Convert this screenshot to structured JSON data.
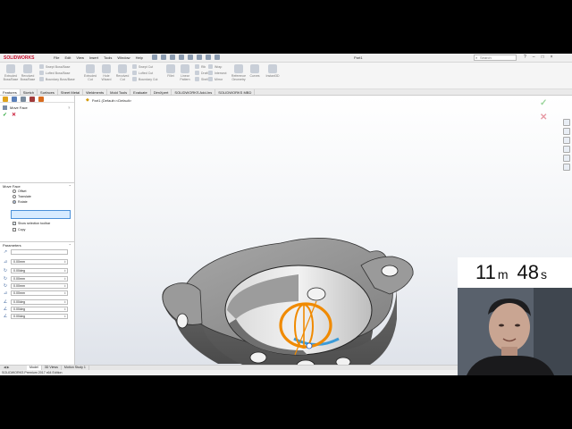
{
  "app": {
    "brand": "SOLIDWORKS",
    "document_title": "Part1",
    "menu": [
      "File",
      "Edit",
      "View",
      "Insert",
      "Tools",
      "Window",
      "Help"
    ],
    "search_placeholder": "Search"
  },
  "ribbon": {
    "groups": [
      {
        "items": [
          "Extruded Boss/Base",
          "Revolved Boss/Base"
        ]
      },
      {
        "items": [
          "Swept Boss/Base",
          "Lofted Boss/Base",
          "Boundary Boss/Base"
        ]
      },
      {
        "items": [
          "Extruded Cut",
          "Hole Wizard",
          "Revolved Cut"
        ]
      },
      {
        "items": [
          "Swept Cut",
          "Lofted Cut",
          "Boundary Cut"
        ]
      },
      {
        "items": [
          "Fillet",
          "Linear Pattern"
        ]
      },
      {
        "items": [
          "Rib",
          "Draft",
          "Shell"
        ]
      },
      {
        "items": [
          "Wrap",
          "Intersect",
          "Mirror"
        ]
      },
      {
        "items": [
          "Reference Geometry",
          "Curves"
        ]
      },
      {
        "items": [
          "Instant3D"
        ]
      }
    ]
  },
  "tabs": [
    "Features",
    "Sketch",
    "Surfaces",
    "Sheet Metal",
    "Weldments",
    "Mold Tools",
    "Evaluate",
    "DimXpert",
    "SOLIDWORKS Add-Ins",
    "SOLIDWORKS MBD"
  ],
  "property_manager": {
    "title": "Move Face",
    "section_move_face": "Move Face",
    "options": [
      "Offset",
      "Translate",
      "Rotate"
    ],
    "selected_option": "Rotate",
    "show_selection_toolbar": "Show selection toolbar",
    "copy": "Copy",
    "section_parameters": "Parameters",
    "params": [
      "0.00mm",
      "0.00deg",
      "0.00mm",
      "0.00mm",
      "0.00mm",
      "0.00deg",
      "0.00deg",
      "0.00deg"
    ]
  },
  "viewport": {
    "tree_label": "Part1 (Default<<Default>"
  },
  "bottom_tabs": [
    "Model",
    "3D Views",
    "Motion Study 1"
  ],
  "status": "SOLIDWORKS Premium 2017 x64 Edition",
  "timer": {
    "minutes": "11",
    "minutes_unit": "m",
    "seconds": "48",
    "seconds_unit": "s"
  },
  "colors": {
    "brand": "#c8102e",
    "triad_orange": "#f08a00",
    "selection_blue": "#d7ebff",
    "model_gray": "#8a8a8a"
  }
}
